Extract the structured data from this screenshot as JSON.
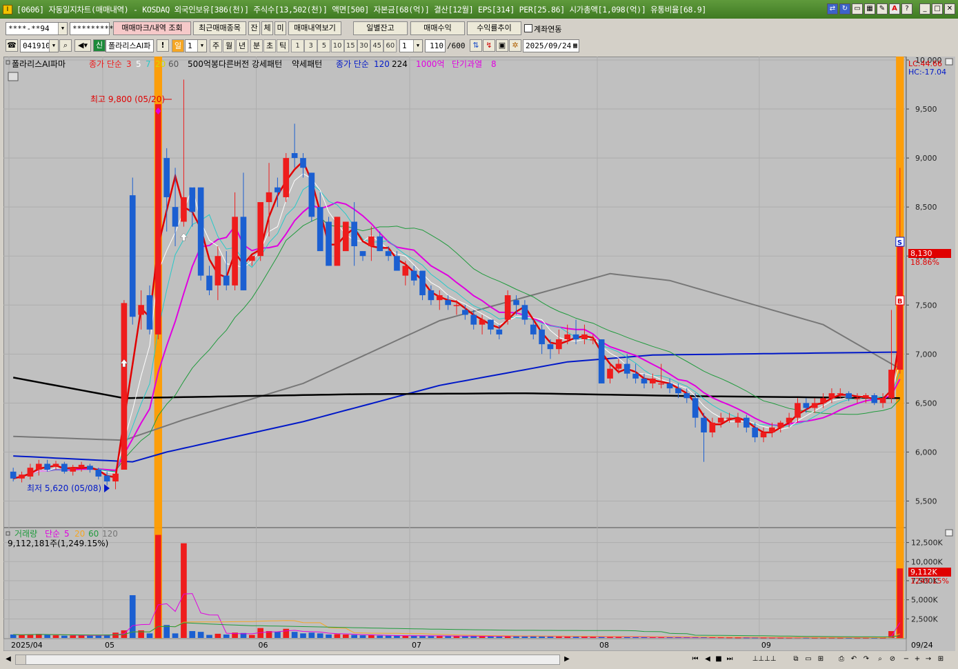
{
  "window": {
    "title": "[0606] 자동일지차트(매매내역) - KOSDAQ 외국인보유[386(천)] 주식수[13,502(천)] 액면[500] 자본금[68(억)] 결산[12월] EPS[314] PER[25.86] 시가총액[1,098(억)] 유통비율[68.9]",
    "app_icon": "I"
  },
  "toolbar1": {
    "account": "****-**94",
    "password": "*********",
    "mark_button": "매매마크/내역 조회",
    "recent_button": "최근매매종목",
    "tab_jan": "잔",
    "tab_che": "체",
    "tab_mi": "미",
    "history_button": "매매내역보기",
    "daily_balance_button": "일별잔고",
    "trade_profit_button": "매매수익",
    "return_trend_button": "수익률추이",
    "account_link_label": "계좌연동"
  },
  "toolbar2": {
    "code": "041910",
    "sin_label": "신",
    "stock_name": "폴라리스AI파",
    "excl": "!",
    "period_il": "일",
    "period_num": "1",
    "period_ju": "주",
    "period_wol": "월",
    "period_nyeon": "년",
    "period_bun": "분",
    "period_cho": "초",
    "period_tick": "틱",
    "intervals": [
      "1",
      "3",
      "5",
      "10",
      "15",
      "30",
      "45",
      "60"
    ],
    "interval_sel": "1",
    "count": "110",
    "count_total": "/600",
    "date": "2025/09/24"
  },
  "legend": {
    "stock": "폴라리스AI파마",
    "ma_label": "종가 단순",
    "ma3": "3",
    "ma5": "5",
    "ma7": "7",
    "ma20": "20",
    "ma60": "60",
    "pattern_text": "500억봉다른버전 강세패턴",
    "weak_pattern": "약세패턴",
    "ma_label2": "종가 단순",
    "ma120": "120",
    "ma224": "224",
    "bil1000": "1000억",
    "overheat": "단기과열",
    "overheat_n": "8"
  },
  "colors": {
    "bg": "#c0c0c0",
    "up": "#ee1c1c",
    "down": "#1b5fd1",
    "ma3": "#e00000",
    "ma5": "#ffffff",
    "ma7": "#26c9c9",
    "ma10": "#e000e0",
    "ma20": "#1f9a3c",
    "ma60": "#777777",
    "ma120": "#0018c8",
    "ma224": "#000000",
    "highlight": "#ff9c00"
  },
  "annotations": {
    "high_label": "최고 9,800 (05/20)",
    "low_label": "최저 5,620 (05/08)",
    "lc": "LC:44.66",
    "hc": "HC:-17.04",
    "current_price": "8,130",
    "current_pct": "18.86%",
    "sell_mark": "S",
    "buy_mark": "B"
  },
  "volume": {
    "legend_label": "거래량",
    "ma_label": "단순",
    "ma5": "5",
    "ma20": "20",
    "ma60": "60",
    "ma120": "120",
    "info": "9,112,181주(1,249.15%)",
    "current": "9,112K",
    "current_pct": "1249.15%"
  },
  "chart_data": {
    "type": "candlestick",
    "price_ylim": [
      5250,
      10000
    ],
    "price_ticks": [
      5500,
      6000,
      6500,
      7000,
      7500,
      8000,
      8500,
      9000,
      9500,
      10000
    ],
    "price_tick_labels": [
      "5,500",
      "6,000",
      "6,500",
      "7,000",
      "7,500",
      "8,000",
      "8,500",
      "9,000",
      "9,500",
      "10,000"
    ],
    "volume_ylim": [
      0,
      14000
    ],
    "volume_ticks": [
      2500,
      5000,
      7500,
      10000,
      12500
    ],
    "volume_tick_labels": [
      "2,500K",
      "5,000K",
      "7,500K",
      "10,000K",
      "12,500K"
    ],
    "x_labels": [
      {
        "label": "2025/04",
        "index": 0
      },
      {
        "label": "05",
        "index": 11
      },
      {
        "label": "06",
        "index": 29
      },
      {
        "label": "07",
        "index": 47
      },
      {
        "label": "08",
        "index": 69
      },
      {
        "label": "09",
        "index": 88
      },
      {
        "label": "09/24",
        "index": 104
      }
    ],
    "candles": [
      [
        5800,
        5840,
        5700,
        5730,
        450
      ],
      [
        5730,
        5800,
        5690,
        5770,
        380
      ],
      [
        5750,
        5880,
        5720,
        5840,
        500
      ],
      [
        5820,
        5920,
        5760,
        5880,
        520
      ],
      [
        5880,
        5920,
        5800,
        5820,
        400
      ],
      [
        5850,
        5910,
        5820,
        5880,
        350
      ],
      [
        5880,
        5900,
        5780,
        5800,
        300
      ],
      [
        5800,
        5870,
        5760,
        5840,
        330
      ],
      [
        5840,
        5900,
        5800,
        5870,
        360
      ],
      [
        5860,
        5880,
        5790,
        5820,
        300
      ],
      [
        5820,
        5840,
        5720,
        5750,
        320
      ],
      [
        5760,
        5800,
        5660,
        5700,
        450
      ],
      [
        5700,
        5800,
        5620,
        5780,
        700
      ],
      [
        5820,
        7550,
        5820,
        7520,
        1000
      ],
      [
        8620,
        8800,
        7300,
        7380,
        5600
      ],
      [
        7400,
        7650,
        7250,
        7500,
        1000
      ],
      [
        7600,
        7700,
        7200,
        7250,
        600
      ],
      [
        7200,
        9550,
        7150,
        9550,
        13500
      ],
      [
        9000,
        9100,
        8250,
        8600,
        1700
      ],
      [
        8500,
        8900,
        8100,
        8300,
        600
      ],
      [
        8350,
        9800,
        8300,
        8600,
        12400
      ],
      [
        8700,
        8700,
        8300,
        8450,
        900
      ],
      [
        8700,
        8700,
        7750,
        7800,
        800
      ],
      [
        7800,
        7900,
        7600,
        7650,
        400
      ],
      [
        7700,
        8100,
        7550,
        8000,
        550
      ],
      [
        7800,
        8050,
        7650,
        7700,
        450
      ],
      [
        7700,
        8650,
        7650,
        8400,
        700
      ],
      [
        8400,
        8850,
        7650,
        7650,
        650
      ],
      [
        7950,
        8000,
        7900,
        8000,
        400
      ],
      [
        8000,
        8500,
        7950,
        8550,
        1300
      ],
      [
        8550,
        8950,
        8200,
        8650,
        900
      ],
      [
        8700,
        8800,
        8500,
        8650,
        800
      ],
      [
        8600,
        9050,
        8550,
        9000,
        1200
      ],
      [
        9050,
        9350,
        8900,
        9000,
        800
      ],
      [
        9000,
        9050,
        8800,
        8900,
        600
      ],
      [
        8850,
        8850,
        8350,
        8400,
        700
      ],
      [
        8500,
        8650,
        8100,
        8050,
        600
      ],
      [
        8350,
        8400,
        7900,
        7900,
        450
      ],
      [
        7900,
        8400,
        7950,
        8400,
        500
      ],
      [
        8050,
        8350,
        8150,
        8350,
        450
      ],
      [
        8350,
        8550,
        7900,
        8100,
        400
      ],
      [
        8050,
        8050,
        7950,
        8000,
        350
      ],
      [
        8100,
        8300,
        7950,
        8200,
        350
      ],
      [
        8200,
        8250,
        8050,
        8050,
        300
      ],
      [
        8050,
        8100,
        7950,
        8000,
        300
      ],
      [
        8000,
        8050,
        7850,
        7850,
        300
      ],
      [
        7800,
        7950,
        7700,
        7900,
        280
      ],
      [
        7850,
        7900,
        7700,
        7750,
        300
      ],
      [
        7850,
        7850,
        7550,
        7600,
        280
      ],
      [
        7650,
        7700,
        7500,
        7550,
        260
      ],
      [
        7550,
        7650,
        7450,
        7600,
        260
      ],
      [
        7550,
        7600,
        7450,
        7500,
        250
      ],
      [
        7500,
        7550,
        7400,
        7500,
        240
      ],
      [
        7450,
        7500,
        7350,
        7400,
        220
      ],
      [
        7400,
        7450,
        7250,
        7300,
        240
      ],
      [
        7300,
        7400,
        7200,
        7350,
        230
      ],
      [
        7350,
        7350,
        7200,
        7250,
        210
      ],
      [
        7250,
        7300,
        7150,
        7200,
        200
      ],
      [
        7350,
        7650,
        7300,
        7600,
        280
      ],
      [
        7550,
        7600,
        7400,
        7500,
        240
      ],
      [
        7500,
        7550,
        7300,
        7350,
        220
      ],
      [
        7300,
        7350,
        7150,
        7200,
        200
      ],
      [
        7250,
        7300,
        7000,
        7100,
        200
      ],
      [
        7100,
        7150,
        6950,
        7050,
        180
      ],
      [
        7050,
        7250,
        7000,
        7150,
        200
      ],
      [
        7150,
        7300,
        7100,
        7200,
        180
      ],
      [
        7200,
        7350,
        7100,
        7150,
        170
      ],
      [
        7150,
        7300,
        7100,
        7200,
        170
      ],
      [
        7150,
        7200,
        7100,
        7150,
        150
      ],
      [
        7150,
        7150,
        6700,
        6700,
        160
      ],
      [
        6750,
        6900,
        6700,
        6850,
        140
      ],
      [
        6850,
        6950,
        6800,
        6900,
        130
      ],
      [
        6900,
        7000,
        6750,
        6800,
        130
      ],
      [
        6800,
        6900,
        6700,
        6750,
        120
      ],
      [
        6750,
        6800,
        6650,
        6700,
        110
      ],
      [
        6700,
        6800,
        6650,
        6750,
        100
      ],
      [
        6700,
        6900,
        6650,
        6700,
        100
      ],
      [
        6700,
        6750,
        6600,
        6650,
        90
      ],
      [
        6650,
        6700,
        6550,
        6600,
        90
      ],
      [
        6600,
        6650,
        6500,
        6550,
        90
      ],
      [
        6550,
        6600,
        6250,
        6350,
        100
      ],
      [
        6350,
        6400,
        5900,
        6200,
        120
      ],
      [
        6200,
        6350,
        6150,
        6300,
        100
      ],
      [
        6300,
        6400,
        6250,
        6350,
        80
      ],
      [
        6350,
        6400,
        6300,
        6350,
        70
      ],
      [
        6300,
        6400,
        6250,
        6350,
        60
      ],
      [
        6350,
        6380,
        6200,
        6250,
        60
      ],
      [
        6250,
        6300,
        6100,
        6150,
        60
      ],
      [
        6150,
        6250,
        6100,
        6200,
        55
      ],
      [
        6200,
        6300,
        6150,
        6250,
        55
      ],
      [
        6250,
        6320,
        6200,
        6300,
        50
      ],
      [
        6300,
        6400,
        6250,
        6350,
        55
      ],
      [
        6350,
        6550,
        6300,
        6500,
        70
      ],
      [
        6500,
        6550,
        6400,
        6450,
        55
      ],
      [
        6450,
        6550,
        6400,
        6500,
        50
      ],
      [
        6500,
        6600,
        6450,
        6550,
        50
      ],
      [
        6550,
        6650,
        6500,
        6600,
        50
      ],
      [
        6600,
        6650,
        6550,
        6600,
        45
      ],
      [
        6600,
        6620,
        6520,
        6550,
        45
      ],
      [
        6550,
        6600,
        6500,
        6550,
        40
      ],
      [
        6550,
        6600,
        6500,
        6580,
        40
      ],
      [
        6580,
        6600,
        6480,
        6500,
        40
      ],
      [
        6500,
        6600,
        6450,
        6550,
        45
      ],
      [
        6550,
        7450,
        6500,
        6840,
        900
      ],
      [
        6840,
        8900,
        6800,
        8130,
        9112
      ]
    ]
  }
}
